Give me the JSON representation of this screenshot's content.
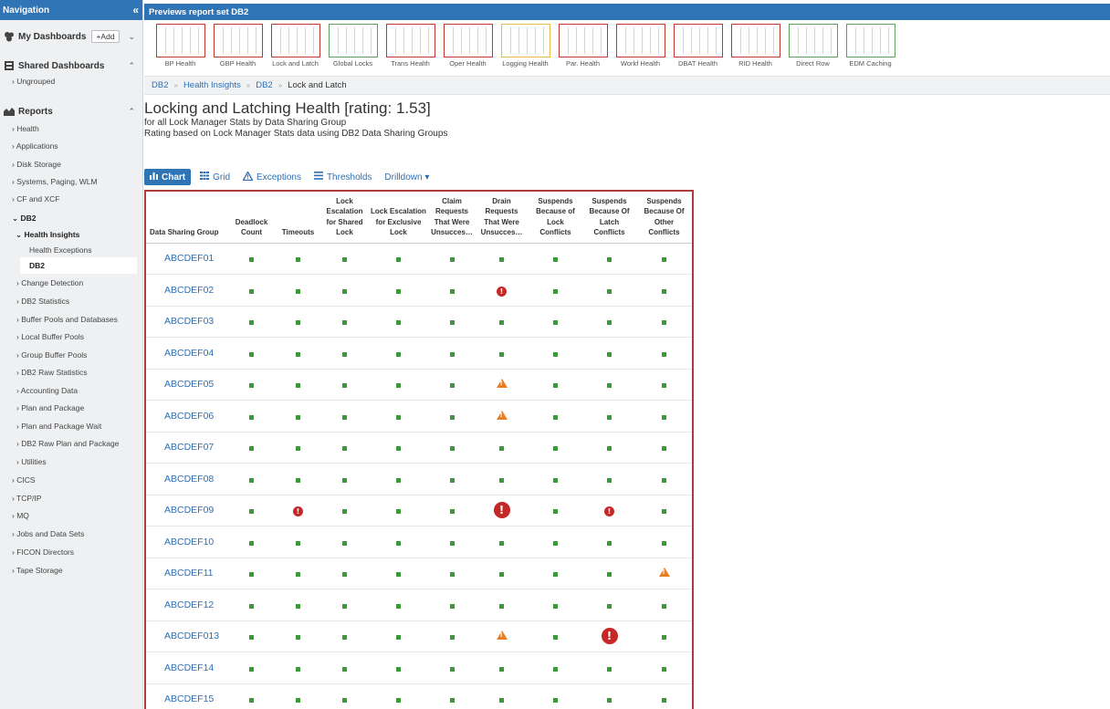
{
  "nav": {
    "title": "Navigation",
    "collapse_icon": "«",
    "my_dashboards": "My Dashboards",
    "add_button": "+Add",
    "shared_dashboards": "Shared Dashboards",
    "ungrouped": "› Ungrouped",
    "reports": "Reports",
    "items": [
      {
        "label": "› Health"
      },
      {
        "label": "› Applications"
      },
      {
        "label": "› Disk Storage"
      },
      {
        "label": "› Systems, Paging, WLM"
      },
      {
        "label": "› CF and XCF"
      },
      {
        "label": "⌄ DB2"
      },
      {
        "label": "⌄ Health Insights"
      },
      {
        "label": "Health Exceptions"
      },
      {
        "label": "DB2"
      },
      {
        "label": "› Change Detection"
      },
      {
        "label": "› DB2 Statistics"
      },
      {
        "label": "› Buffer Pools and Databases"
      },
      {
        "label": "› Local Buffer Pools"
      },
      {
        "label": "› Group Buffer Pools"
      },
      {
        "label": "› DB2 Raw Statistics"
      },
      {
        "label": "› Accounting Data"
      },
      {
        "label": "› Plan and Package"
      },
      {
        "label": "› Plan and Package Wait"
      },
      {
        "label": "› DB2 Raw Plan and Package"
      },
      {
        "label": "› Utilities"
      },
      {
        "label": "› CICS"
      },
      {
        "label": "› TCP/IP"
      },
      {
        "label": "› MQ"
      },
      {
        "label": "› Jobs and Data Sets"
      },
      {
        "label": "› FICON Directors"
      },
      {
        "label": "› Tape Storage"
      }
    ]
  },
  "preview": {
    "title": "Previews report set DB2",
    "thumbnails": [
      {
        "label": "BP Health",
        "status": "red"
      },
      {
        "label": "GBP Health",
        "status": "red"
      },
      {
        "label": "Lock and Latch",
        "status": "red"
      },
      {
        "label": "Global Locks",
        "status": "green"
      },
      {
        "label": "Trans Health",
        "status": "red"
      },
      {
        "label": "Oper Health",
        "status": "red"
      },
      {
        "label": "Logging Health",
        "status": "yellow"
      },
      {
        "label": "Par. Health",
        "status": "red"
      },
      {
        "label": "Workf Health",
        "status": "red"
      },
      {
        "label": "DBAT Health",
        "status": "red"
      },
      {
        "label": "RID Health",
        "status": "red"
      },
      {
        "label": "Direct Row",
        "status": "green"
      },
      {
        "label": "EDM Caching",
        "status": "green"
      }
    ],
    "status_colors": {
      "red": "#c0392b",
      "green": "#5aa25a",
      "yellow": "#e8b84a"
    }
  },
  "breadcrumb": {
    "items": [
      "DB2",
      "Health Insights",
      "DB2"
    ],
    "current": "Lock and Latch",
    "separator": "»"
  },
  "title": {
    "heading": "Locking and Latching Health [rating: 1.53]",
    "subtitle1": "for all Lock Manager Stats by Data Sharing Group",
    "subtitle2": "Rating based on Lock Manager Stats data using DB2 Data Sharing Groups"
  },
  "toolbar": {
    "chart": "Chart",
    "grid": "Grid",
    "exceptions": "Exceptions",
    "thresholds": "Thresholds",
    "drilldown": "Drilldown ▾"
  },
  "table": {
    "columns": [
      "Data Sharing Group",
      "Deadlock Count",
      "Timeouts",
      "Lock Escalation for Shared Lock",
      "Lock Escalation for Exclusive Lock",
      "Claim Requests That Were Unsucces…",
      "Drain Requests That Were Unsucces…",
      "Suspends Because of Lock Conflicts",
      "Suspends Because Of Latch Conflicts",
      "Suspends Because Of Other Conflicts"
    ],
    "rows": [
      {
        "name": "ABCDEF01",
        "cells": [
          "ok",
          "ok",
          "ok",
          "ok",
          "ok",
          "ok",
          "ok",
          "ok",
          "ok"
        ]
      },
      {
        "name": "ABCDEF02",
        "cells": [
          "ok",
          "ok",
          "ok",
          "ok",
          "ok",
          "err",
          "ok",
          "ok",
          "ok"
        ]
      },
      {
        "name": "ABCDEF03",
        "cells": [
          "ok",
          "ok",
          "ok",
          "ok",
          "ok",
          "ok",
          "ok",
          "ok",
          "ok"
        ]
      },
      {
        "name": "ABCDEF04",
        "cells": [
          "ok",
          "ok",
          "ok",
          "ok",
          "ok",
          "ok",
          "ok",
          "ok",
          "ok"
        ]
      },
      {
        "name": "ABCDEF05",
        "cells": [
          "ok",
          "ok",
          "ok",
          "ok",
          "ok",
          "warn",
          "ok",
          "ok",
          "ok"
        ]
      },
      {
        "name": "ABCDEF06",
        "cells": [
          "ok",
          "ok",
          "ok",
          "ok",
          "ok",
          "warn",
          "ok",
          "ok",
          "ok"
        ]
      },
      {
        "name": "ABCDEF07",
        "cells": [
          "ok",
          "ok",
          "ok",
          "ok",
          "ok",
          "ok",
          "ok",
          "ok",
          "ok"
        ]
      },
      {
        "name": "ABCDEF08",
        "cells": [
          "ok",
          "ok",
          "ok",
          "ok",
          "ok",
          "ok",
          "ok",
          "ok",
          "ok"
        ]
      },
      {
        "name": "ABCDEF09",
        "cells": [
          "ok",
          "err",
          "ok",
          "ok",
          "ok",
          "errbig",
          "ok",
          "err",
          "ok"
        ]
      },
      {
        "name": "ABCDEF10",
        "cells": [
          "ok",
          "ok",
          "ok",
          "ok",
          "ok",
          "ok",
          "ok",
          "ok",
          "ok"
        ]
      },
      {
        "name": "ABCDEF11",
        "cells": [
          "ok",
          "ok",
          "ok",
          "ok",
          "ok",
          "ok",
          "ok",
          "ok",
          "warn"
        ]
      },
      {
        "name": "ABCDEF12",
        "cells": [
          "ok",
          "ok",
          "ok",
          "ok",
          "ok",
          "ok",
          "ok",
          "ok",
          "ok"
        ]
      },
      {
        "name": "ABCDEF013",
        "cells": [
          "ok",
          "ok",
          "ok",
          "ok",
          "ok",
          "warn",
          "ok",
          "errbig",
          "ok"
        ]
      },
      {
        "name": "ABCDEF14",
        "cells": [
          "ok",
          "ok",
          "ok",
          "ok",
          "ok",
          "ok",
          "ok",
          "ok",
          "ok"
        ]
      },
      {
        "name": "ABCDEF15",
        "cells": [
          "ok",
          "ok",
          "ok",
          "ok",
          "ok",
          "ok",
          "ok",
          "ok",
          "ok"
        ]
      }
    ]
  },
  "colors": {
    "accent": "#2f74b5",
    "ok": "#3a9a3a",
    "error": "#c62828",
    "warning": "#e67e22",
    "frame": "#b03a3a"
  }
}
